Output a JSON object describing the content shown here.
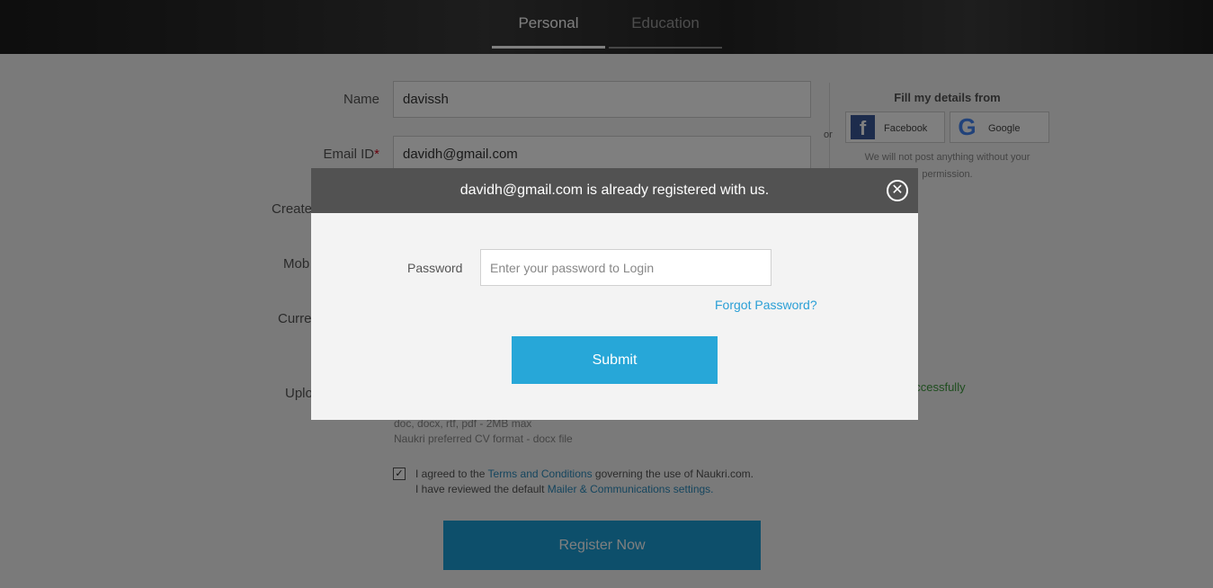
{
  "tabs": [
    {
      "label": "Personal",
      "active": true
    },
    {
      "label": "Education",
      "active": false
    }
  ],
  "form": {
    "name_label": "Name",
    "name_value": "davissh",
    "email_label": "Email ID",
    "email_required_mark": "*",
    "email_value": "davidh@gmail.com",
    "create_label": "Create",
    "mobile_label": "Mob",
    "current_label": "Curre",
    "upload_label": "Uplo",
    "upload_success": "uccessfully",
    "upload_hint_formats": "doc, docx, rtf, pdf - 2MB max",
    "upload_hint_preferred": "Naukri preferred CV format - docx file",
    "or_text": "or",
    "fill_title": "Fill my details from",
    "facebook_label": "Facebook",
    "google_label": "Google",
    "social_note_line1": "We will not post anything without your",
    "social_note_line2": "permission.",
    "agree_checked": true,
    "agree_line1_prefix": "I agreed to the ",
    "agree_terms_link": "Terms and Conditions",
    "agree_line1_suffix": " governing the use of Naukri.com.",
    "agree_line2_prefix": "I have reviewed the default ",
    "agree_mailer_link": "Mailer & Communications settings.",
    "register_label": "Register Now"
  },
  "modal": {
    "title": "davidh@gmail.com is already registered with us.",
    "close_glyph": "✕",
    "password_label": "Password",
    "password_placeholder": "Enter your password to Login",
    "forgot_label": "Forgot Password?",
    "submit_label": "Submit"
  },
  "colors": {
    "accent": "#27a7d8",
    "modal_header": "#525252",
    "success": "#3c9b3c",
    "link": "#2a8bbd"
  }
}
